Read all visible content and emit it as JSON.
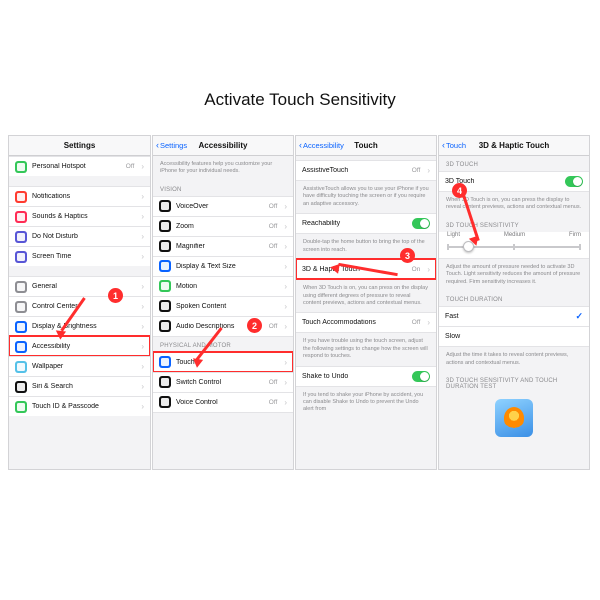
{
  "title": "Activate Touch Sensitivity",
  "step_badges": [
    "1",
    "2",
    "3",
    "4"
  ],
  "panel1": {
    "header": "Settings",
    "rows": [
      {
        "icon": "#34c759",
        "label": "Personal Hotspot",
        "trail": "Off",
        "chev": true
      },
      {
        "gap": true
      },
      {
        "icon": "#ff3b30",
        "label": "Notifications",
        "chev": true
      },
      {
        "icon": "#ff2d55",
        "label": "Sounds & Haptics",
        "chev": true
      },
      {
        "icon": "#5856d6",
        "label": "Do Not Disturb",
        "chev": true
      },
      {
        "icon": "#5856d6",
        "label": "Screen Time",
        "chev": true
      },
      {
        "gap": true
      },
      {
        "icon": "#8e8e93",
        "label": "General",
        "chev": true
      },
      {
        "icon": "#8e8e93",
        "label": "Control Center",
        "chev": true
      },
      {
        "icon": "#0a63ff",
        "label": "Display & Brightness",
        "chev": true
      },
      {
        "icon": "#0a63ff",
        "label": "Accessibility",
        "chev": true,
        "hl": true
      },
      {
        "icon": "#55c1e8",
        "label": "Wallpaper",
        "chev": true
      },
      {
        "icon": "#111111",
        "label": "Siri & Search",
        "chev": true
      },
      {
        "icon": "#34c759",
        "label": "Touch ID & Passcode",
        "chev": true
      }
    ]
  },
  "panel2": {
    "back": "Settings",
    "header": "Accessibility",
    "intro": "Accessibility features help you customize your iPhone for your individual needs.",
    "section_vision": "VISION",
    "vision_rows": [
      {
        "icon": "#111111",
        "label": "VoiceOver",
        "trail": "Off",
        "chev": true
      },
      {
        "icon": "#111111",
        "label": "Zoom",
        "trail": "Off",
        "chev": true
      },
      {
        "icon": "#111111",
        "label": "Magnifier",
        "trail": "Off",
        "chev": true
      },
      {
        "icon": "#0a63ff",
        "label": "Display & Text Size",
        "chev": true
      },
      {
        "icon": "#34c759",
        "label": "Motion",
        "chev": true
      },
      {
        "icon": "#111111",
        "label": "Spoken Content",
        "chev": true
      },
      {
        "icon": "#111111",
        "label": "Audio Descriptions",
        "trail": "Off",
        "chev": true
      }
    ],
    "section_motor": "PHYSICAL AND MOTOR",
    "motor_rows": [
      {
        "icon": "#0a63ff",
        "label": "Touch",
        "chev": true,
        "hl": true
      },
      {
        "icon": "#111111",
        "label": "Switch Control",
        "trail": "Off",
        "chev": true
      },
      {
        "icon": "#111111",
        "label": "Voice Control",
        "trail": "Off",
        "chev": true
      }
    ]
  },
  "panel3": {
    "back": "Accessibility",
    "header": "Touch",
    "assistive": {
      "label": "AssistiveTouch",
      "trail": "Off"
    },
    "assistive_desc": "AssistiveTouch allows you to use your iPhone if you have difficulty touching the screen or if you require an adaptive accessory.",
    "reach": {
      "label": "Reachability"
    },
    "reach_desc": "Double-tap the home button to bring the top of the screen into reach.",
    "haptic": {
      "label": "3D & Haptic Touch",
      "trail": "On"
    },
    "haptic_desc": "When 3D Touch is on, you can press on the display using different degrees of pressure to reveal content previews, actions and contextual menus.",
    "accom": {
      "label": "Touch Accommodations",
      "trail": "Off"
    },
    "accom_desc": "If you have trouble using the touch screen, adjust the following settings to change how the screen will respond to touches.",
    "shake": {
      "label": "Shake to Undo"
    },
    "shake_desc": "If you tend to shake your iPhone by accident, you can disable Shake to Undo to prevent the Undo alert from"
  },
  "panel4": {
    "back": "Touch",
    "header": "3D & Haptic Touch",
    "sec1": "3D TOUCH",
    "row1": {
      "label": "3D Touch"
    },
    "row1_desc": "When 3D Touch is on, you can press the display to reveal content previews, actions and contextual menus.",
    "sec2": "3D TOUCH SENSITIVITY",
    "slider_labels": [
      "Light",
      "Medium",
      "Firm"
    ],
    "slider_desc": "Adjust the amount of pressure needed to activate 3D Touch. Light sensitivity reduces the amount of pressure required. Firm sensitivity increases it.",
    "sec3": "TOUCH DURATION",
    "fast": "Fast",
    "slow": "Slow",
    "dur_desc": "Adjust the time it takes to reveal content previews, actions and contextual menus.",
    "sec4": "3D TOUCH SENSITIVITY AND TOUCH DURATION TEST"
  }
}
